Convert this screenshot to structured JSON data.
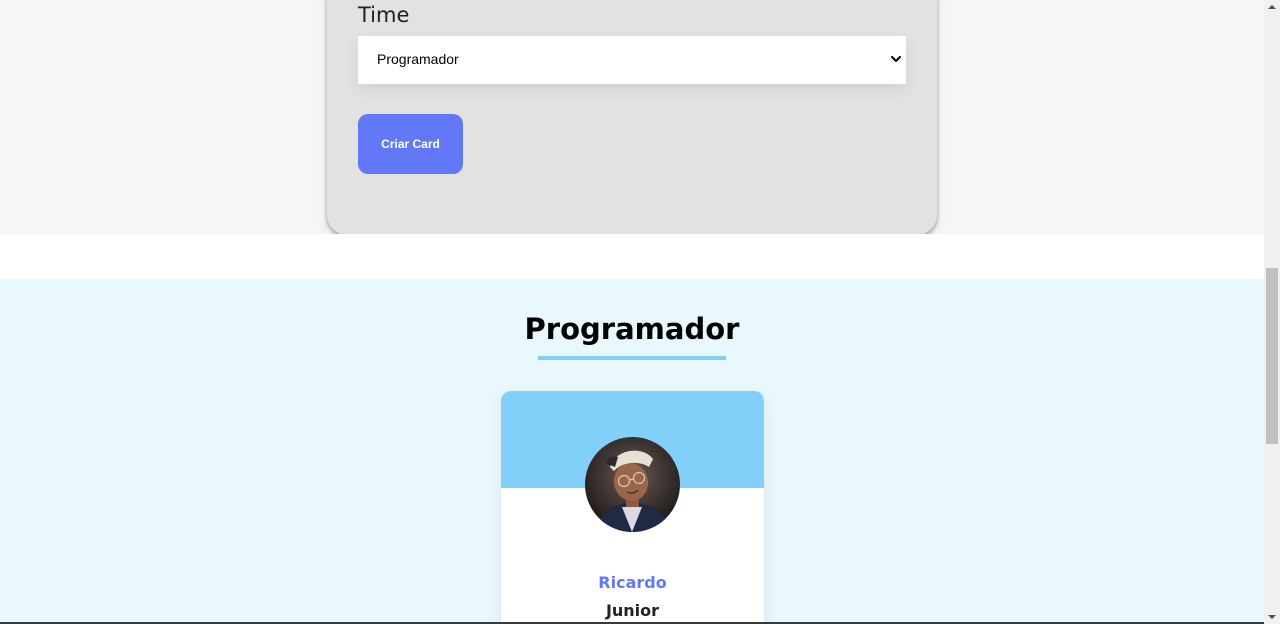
{
  "form": {
    "team_label": "Time",
    "team_select_value": "Programador",
    "create_button_label": "Criar Card"
  },
  "team_section": {
    "title": "Programador",
    "accent_color": "#82cffa",
    "background_color": "#e8f8fd",
    "cards": [
      {
        "name": "Ricardo",
        "role": "Junior",
        "avatar_icon": "person-avatar-photo"
      }
    ]
  },
  "colors": {
    "primary_button": "#6278f7",
    "form_panel": "#e2e2e2",
    "card_name": "#6278f7"
  },
  "icons": {
    "select_chevron": "chevron-down-icon",
    "scroll_up": "scroll-up-arrow-icon",
    "scroll_down": "scroll-down-arrow-icon"
  }
}
